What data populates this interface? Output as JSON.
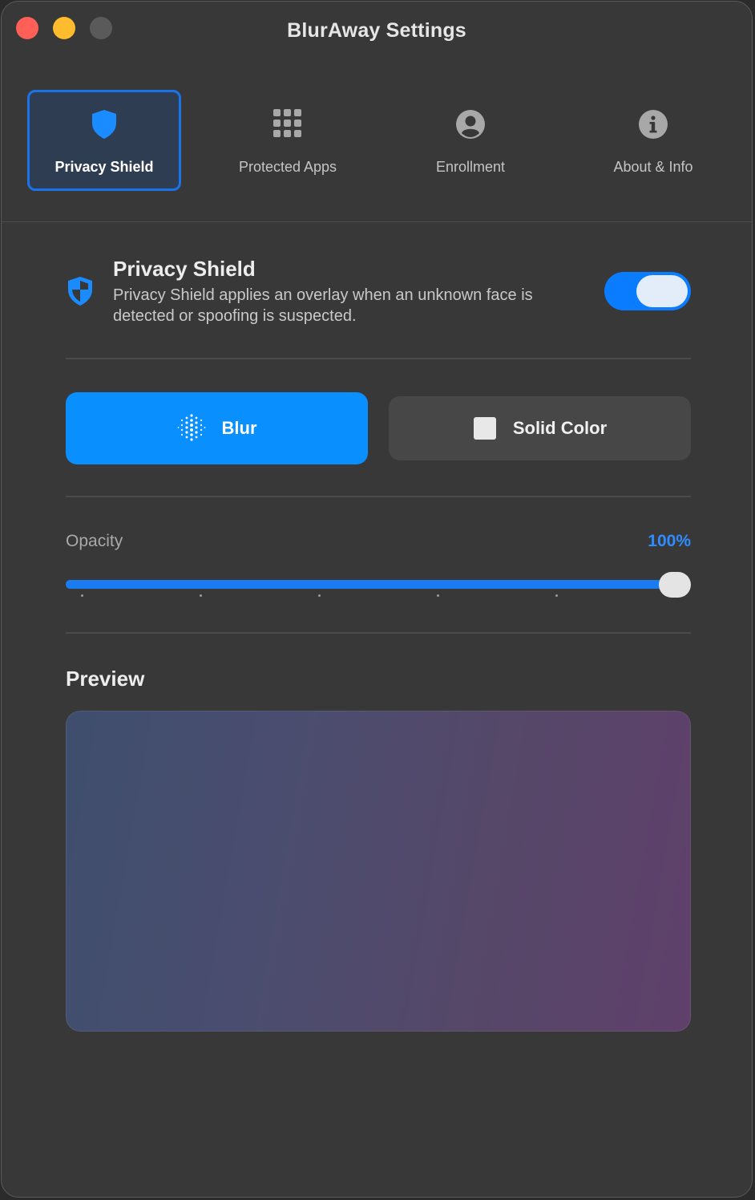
{
  "window": {
    "title": "BlurAway Settings"
  },
  "tabs": [
    {
      "label": "Privacy Shield",
      "icon": "shield-icon",
      "active": true
    },
    {
      "label": "Protected Apps",
      "icon": "app-grid-icon",
      "active": false
    },
    {
      "label": "Enrollment",
      "icon": "person-circle-icon",
      "active": false
    },
    {
      "label": "About & Info",
      "icon": "info-circle-icon",
      "active": false
    }
  ],
  "privacy_shield": {
    "title": "Privacy Shield",
    "description": "Privacy Shield applies an overlay when an unknown face is detected or spoofing is suspected.",
    "enabled": true,
    "icon": "shield-check-icon"
  },
  "overlay_modes": {
    "selected": "Blur",
    "options": [
      {
        "label": "Blur",
        "icon": "blur-dots-icon"
      },
      {
        "label": "Solid Color",
        "icon": "square-icon"
      }
    ]
  },
  "opacity": {
    "label": "Opacity",
    "value_text": "100%",
    "value": 1.0
  },
  "preview": {
    "title": "Preview"
  },
  "colors": {
    "accent": "#0a8fff",
    "window_bg": "#383838",
    "close": "#fe5f57",
    "minimize": "#febc2e"
  }
}
